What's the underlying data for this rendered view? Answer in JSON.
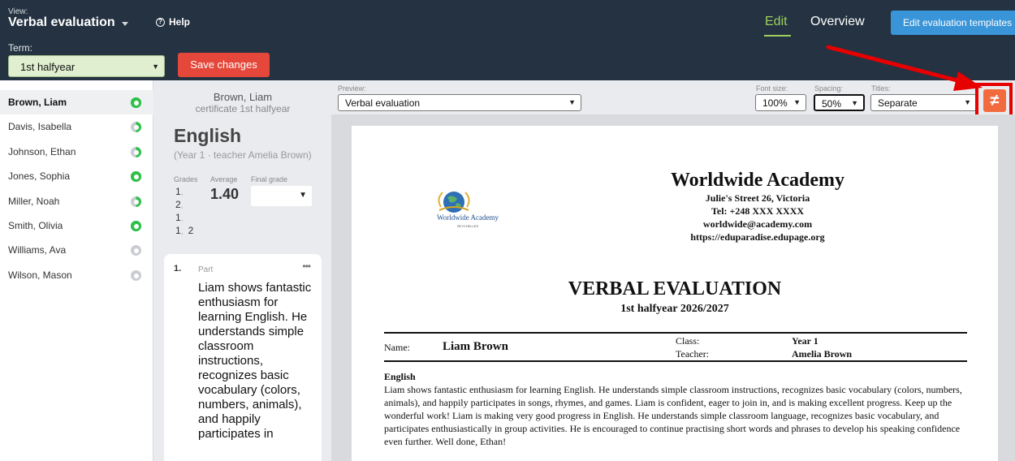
{
  "header": {
    "view_label": "View:",
    "view_value": "Verbal evaluation",
    "help_label": "Help",
    "term_label": "Term:",
    "term_value": "1st halfyear",
    "save_label": "Save changes",
    "tabs": [
      {
        "label": "Edit",
        "active": true
      },
      {
        "label": "Overview",
        "active": false
      }
    ],
    "edit_templates_label": "Edit evaluation templates"
  },
  "students": [
    {
      "name": "Brown, Liam",
      "status": "complete",
      "active": true
    },
    {
      "name": "Davis, Isabella",
      "status": "partial"
    },
    {
      "name": "Johnson, Ethan",
      "status": "partial"
    },
    {
      "name": "Jones, Sophia",
      "status": "complete"
    },
    {
      "name": "Miller, Noah",
      "status": "partial"
    },
    {
      "name": "Smith, Olivia",
      "status": "complete"
    },
    {
      "name": "Williams, Ava",
      "status": "empty"
    },
    {
      "name": "Wilson, Mason",
      "status": "empty"
    }
  ],
  "middle": {
    "student_name": "Brown, Liam",
    "certificate": "certificate 1st halfyear",
    "subject": "English",
    "subject_sub": "(Year 1 · teacher Amelia Brown)",
    "grades_label": "Grades",
    "average_label": "Average",
    "final_grade_label": "Final grade",
    "grades": [
      "1",
      "2",
      "1",
      "1",
      "2"
    ],
    "average": "1.40",
    "final_grade": "",
    "part_number": "1.",
    "part_label": "Part",
    "part_text": "Liam shows fantastic enthusiasm for learning English. He understands simple classroom instructions, recognizes basic vocabulary (colors, numbers, animals), and happily participates in"
  },
  "preview_bar": {
    "preview_label": "Preview:",
    "preview_value": "Verbal evaluation",
    "font_size_label": "Font size:",
    "font_size_value": "100%",
    "spacing_label": "Spacing:",
    "spacing_value": "50%",
    "titles_label": "Titles:",
    "titles_value": "Separate",
    "diff_icon": "not-equal-icon",
    "diff_symbol": "≠"
  },
  "document": {
    "logo_text": "Worldwide Academy",
    "logo_sub": "SEYCHELLES",
    "school_name": "Worldwide Academy",
    "address": "Julie's Street 26, Victoria",
    "tel": "Tel: +248 XXX XXXX",
    "email": "worldwide@academy.com",
    "url": "https://eduparadise.edupage.org",
    "title": "VERBAL EVALUATION",
    "subtitle": "1st halfyear 2026/2027",
    "name_label": "Name:",
    "name_value": "Liam Brown",
    "class_label": "Class:",
    "class_value": "Year 1",
    "teacher_label": "Teacher:",
    "teacher_value": "Amelia Brown",
    "subject_heading": "English",
    "evaluation_text": "Liam shows fantastic enthusiasm for learning English. He understands simple classroom instructions, recognizes basic vocabulary (colors, numbers, animals), and happily participates in songs, rhymes, and games. Liam is confident, eager to join in, and is making excellent progress. Keep up the wonderful work! Liam is making very good progress in English. He understands simple classroom language, recognizes basic vocabulary, and participates enthusiastically in group activities. He is encouraged to continue practising short words and phrases to develop his speaking confidence even further. Well done, Ethan!"
  },
  "colors": {
    "topbar": "#243241",
    "accent_green": "#9ecf5f",
    "save_red": "#e5483a",
    "templates_blue": "#3a95d8",
    "diff_orange": "#f26b3f",
    "annotation_red": "#e60000",
    "status_green": "#2ec04a"
  }
}
